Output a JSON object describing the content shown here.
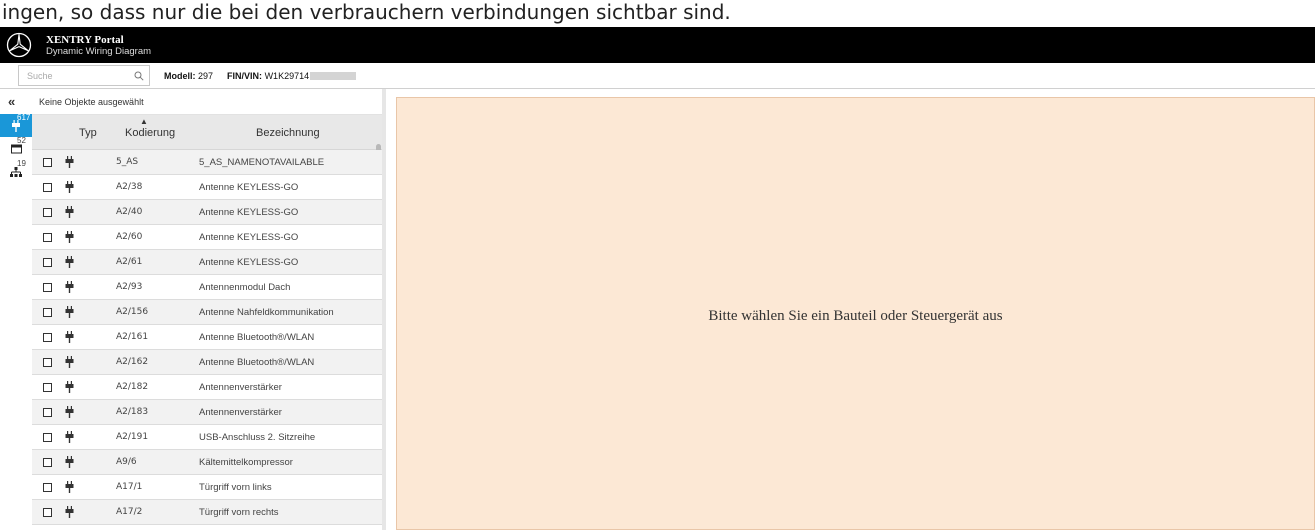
{
  "top_text": "ingen, so dass nur die bei den verbrauchern verbindungen sichtbar sind.",
  "header": {
    "title": "XENTRY Portal",
    "subtitle": "Dynamic Wiring Diagram"
  },
  "toolbar": {
    "search_placeholder": "Suche",
    "model_label": "Modell:",
    "model_value": "297",
    "vin_label": "FIN/VIN:",
    "vin_value": "W1K29714"
  },
  "sidebar": {
    "collapse_icon": "«",
    "tabs": [
      {
        "icon": "plug-icon",
        "count": "617",
        "active": true
      },
      {
        "icon": "control-unit-icon",
        "count": "52",
        "active": false
      },
      {
        "icon": "network-icon",
        "count": "19",
        "active": false
      }
    ]
  },
  "panel": {
    "no_selection": "Keine Objekte ausgewählt",
    "columns": {
      "typ": "Typ",
      "kodierung": "Kodierung",
      "bezeichnung": "Bezeichnung"
    },
    "rows": [
      {
        "kod": "5_AS",
        "bez": "5_AS_NAMENOTAVAILABLE"
      },
      {
        "kod": "A2/38",
        "bez": "Antenne KEYLESS-GO"
      },
      {
        "kod": "A2/40",
        "bez": "Antenne KEYLESS-GO"
      },
      {
        "kod": "A2/60",
        "bez": "Antenne KEYLESS-GO"
      },
      {
        "kod": "A2/61",
        "bez": "Antenne KEYLESS-GO"
      },
      {
        "kod": "A2/93",
        "bez": "Antennenmodul Dach"
      },
      {
        "kod": "A2/156",
        "bez": "Antenne Nahfeldkommunikation"
      },
      {
        "kod": "A2/161",
        "bez": "Antenne Bluetooth®/WLAN"
      },
      {
        "kod": "A2/162",
        "bez": "Antenne Bluetooth®/WLAN"
      },
      {
        "kod": "A2/182",
        "bez": "Antennenverstärker"
      },
      {
        "kod": "A2/183",
        "bez": "Antennenverstärker"
      },
      {
        "kod": "A2/191",
        "bez": "USB-Anschluss 2. Sitzreihe"
      },
      {
        "kod": "A9/6",
        "bez": "Kältemittelkompressor"
      },
      {
        "kod": "A17/1",
        "bez": "Türgriff vorn links"
      },
      {
        "kod": "A17/2",
        "bez": "Türgriff vorn rechts"
      }
    ]
  },
  "content": {
    "hint": "Bitte wählen Sie ein Bauteil oder Steuergerät aus"
  },
  "colors": {
    "header_bg": "#000000",
    "active_tab": "#1a97d8",
    "content_bg": "#fce8d5"
  }
}
